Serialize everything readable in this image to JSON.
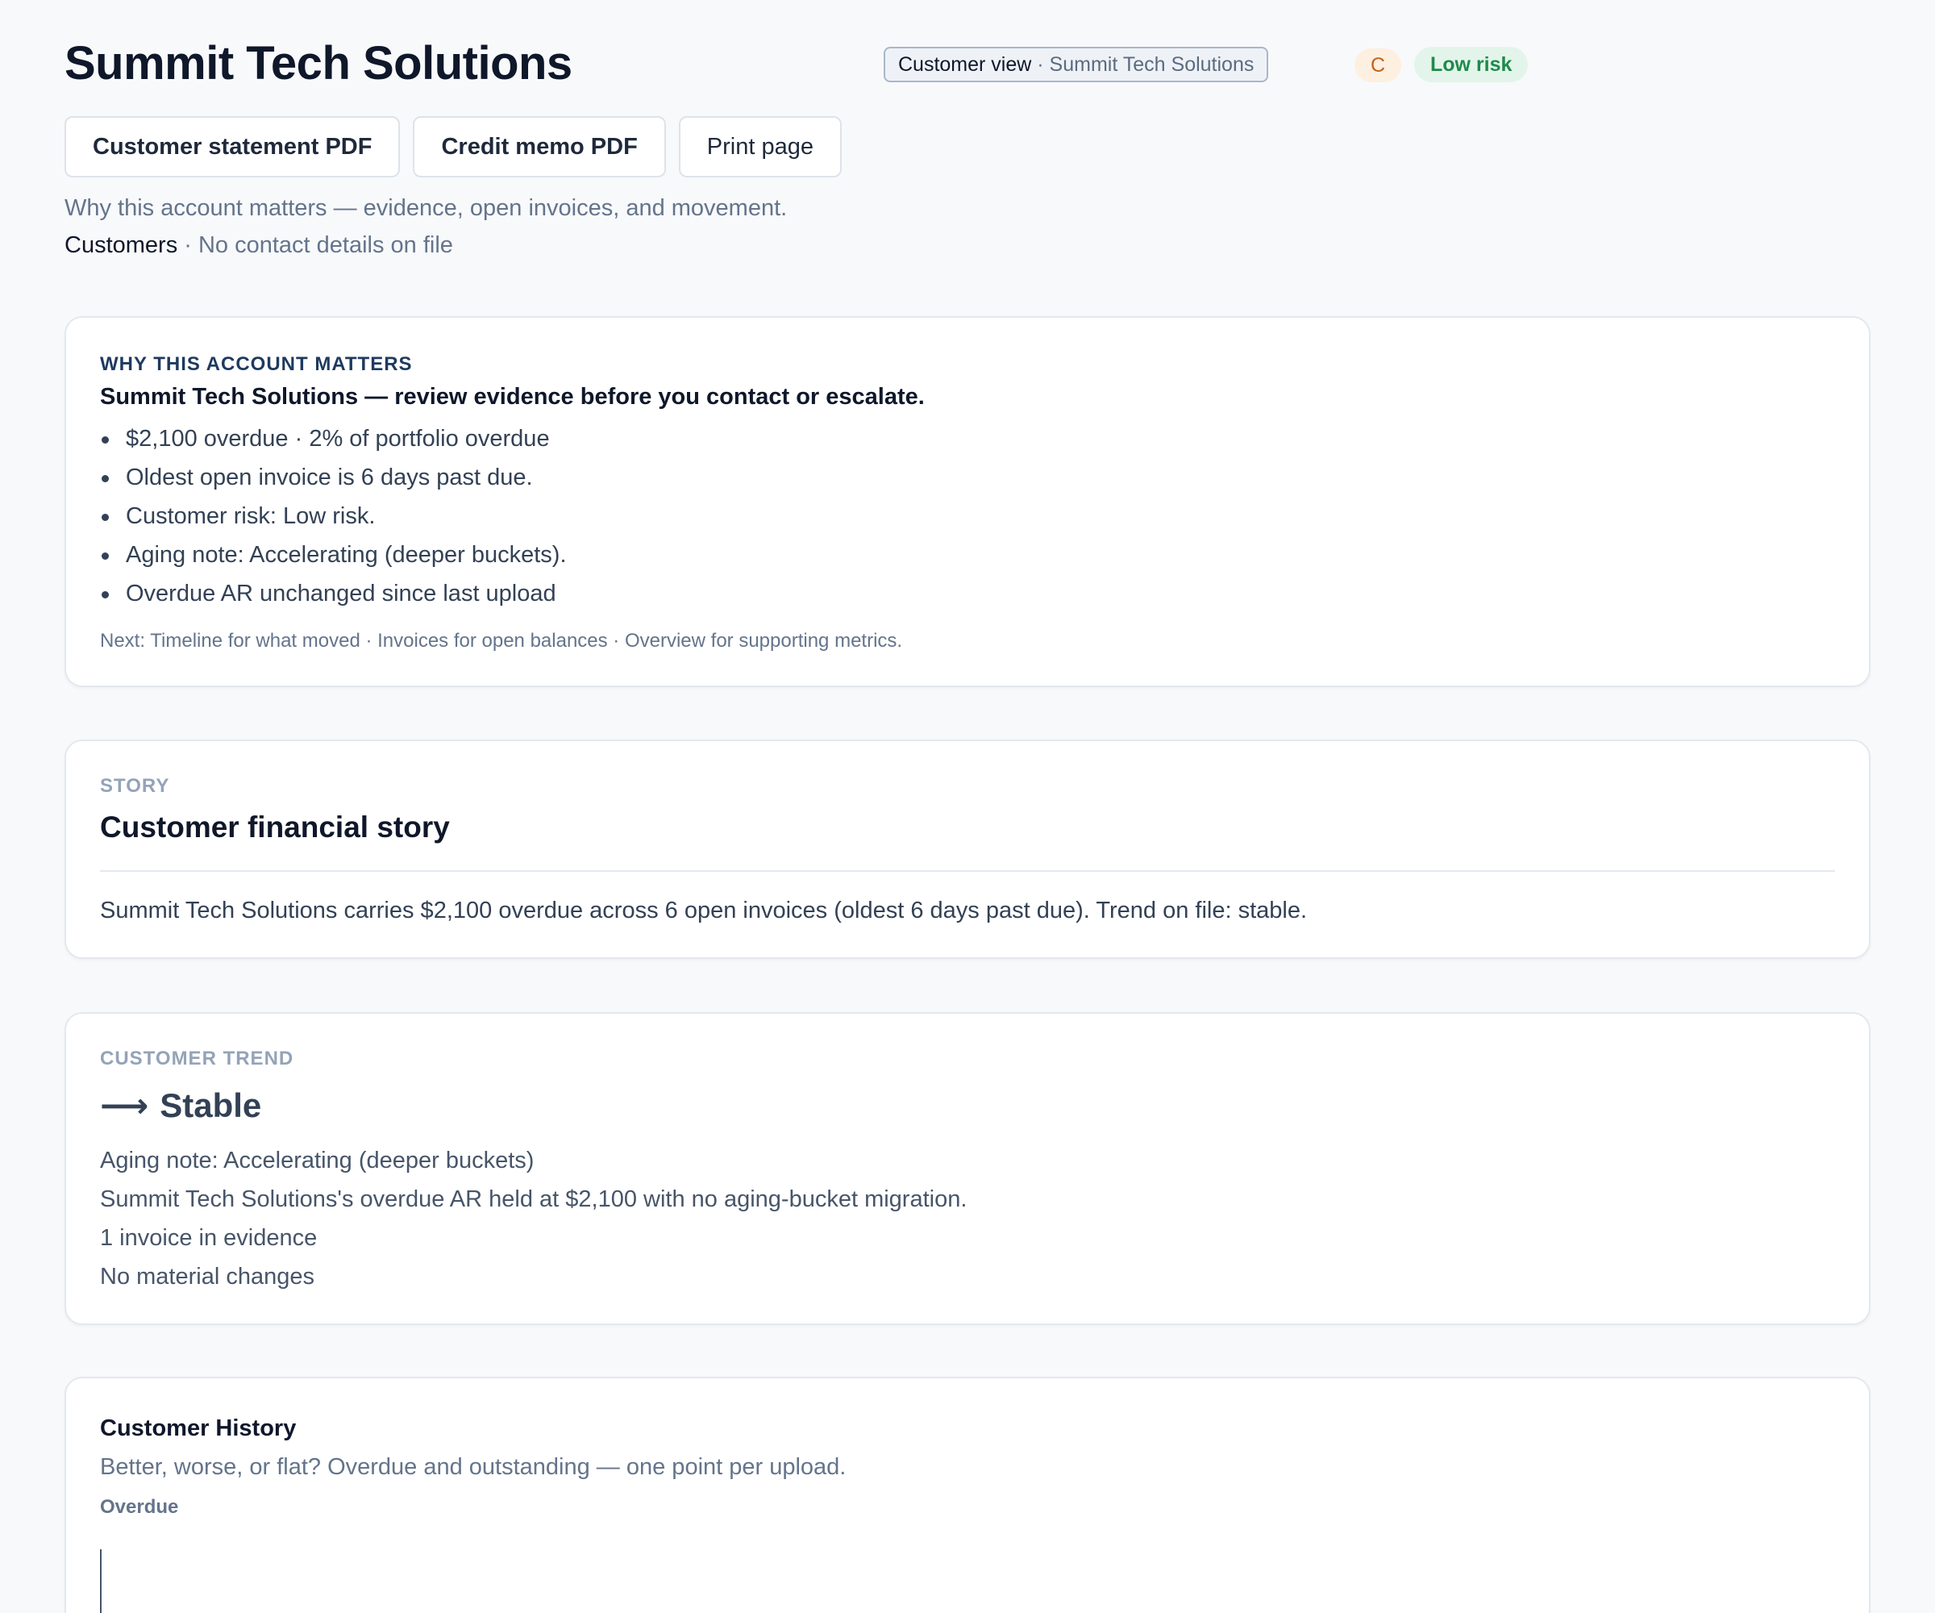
{
  "header": {
    "title": "Summit Tech Solutions",
    "view_pill": {
      "label": "Customer view",
      "separator": " · ",
      "context": "Summit Tech Solutions"
    },
    "avatar_initial": "C",
    "risk_badge": "Low risk"
  },
  "actions": {
    "statement_pdf": "Customer statement PDF",
    "credit_memo_pdf": "Credit memo PDF",
    "print_page": "Print page"
  },
  "subtitle": "Why this account matters — evidence, open invoices, and movement.",
  "breadcrumb": {
    "link": "Customers",
    "detail": " · No contact details on file"
  },
  "why": {
    "eyebrow": "WHY THIS ACCOUNT MATTERS",
    "headline": "Summit Tech Solutions — review evidence before you contact or escalate.",
    "bullets": [
      "$2,100 overdue · 2% of portfolio overdue",
      "Oldest open invoice is 6 days past due.",
      "Customer risk: Low risk.",
      "Aging note: Accelerating (deeper buckets).",
      "Overdue AR unchanged since last upload"
    ],
    "next": "Next: Timeline for what moved · Invoices for open balances · Overview for supporting metrics."
  },
  "story": {
    "eyebrow": "STORY",
    "title": "Customer financial story",
    "text": "Summit Tech Solutions carries $2,100 overdue across 6 open invoices (oldest 6 days past due). Trend on file: stable."
  },
  "trend": {
    "eyebrow": "CUSTOMER TREND",
    "arrow": "⟶",
    "label": "Stable",
    "lines": [
      "Aging note: Accelerating (deeper buckets)",
      "Summit Tech Solutions's overdue AR held at $2,100 with no aging-bucket migration.",
      "1 invoice in evidence",
      "No material changes"
    ]
  },
  "history": {
    "title": "Customer History",
    "subtitle": "Better, worse, or flat? Overdue and outstanding — one point per upload.",
    "series_label": "Overdue"
  },
  "colors": {
    "background": "#f8f9fb",
    "risk_low_bg": "#e3f5ea",
    "risk_low_text": "#1f8a4c",
    "avatar_bg": "#fdf0e1",
    "avatar_text": "#c2621b"
  }
}
